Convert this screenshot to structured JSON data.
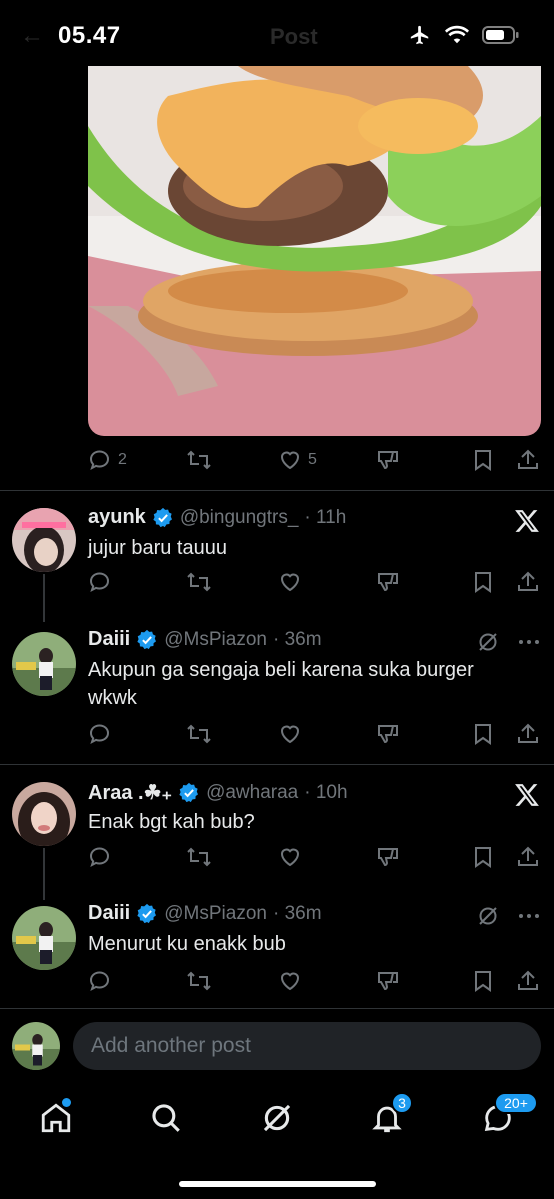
{
  "status_bar": {
    "time": "05.47"
  },
  "header": {
    "title": "Post"
  },
  "main_post": {
    "replies_count": "2",
    "likes_count": "5"
  },
  "replies": [
    {
      "name": "ayunk",
      "handle": "@bingungtrs_",
      "time": "· 11h",
      "text": "jujur baru tauuu"
    },
    {
      "name": "Daiii",
      "handle": "@MsPiazon",
      "time": "· 36m",
      "text": "Akupun ga sengaja beli karena suka burger wkwk"
    },
    {
      "name": "Araa .☘︎₊",
      "handle": "@awharaa",
      "time": "· 10h",
      "text": "Enak bgt kah bub?"
    },
    {
      "name": "Daiii",
      "handle": "@MsPiazon",
      "time": "· 36m",
      "text": "Menurut ku enakk bub"
    }
  ],
  "compose": {
    "placeholder": "Add another post"
  },
  "tabbar": {
    "notifications_badge": "3",
    "messages_badge": "20+"
  },
  "colors": {
    "accent": "#1d9bf0",
    "muted": "#71767b",
    "background": "#000000"
  }
}
